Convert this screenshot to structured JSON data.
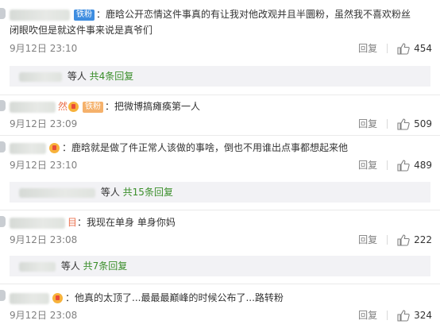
{
  "comments": [
    {
      "badge": "铁粉",
      "text": "：鹿晗公开恋情这件事真的有让我对他改观并且半圜粉，虽然我不喜欢粉丝",
      "text2": "闭眼吹但是就这件事来说是真爷们",
      "time": "9月12日 23:10",
      "reply": "回复",
      "likes": "454",
      "subreply": {
        "who": "等人",
        "count": "共4条回复"
      }
    },
    {
      "name_tail": "然",
      "badge": "铁粉",
      "text": "：把微博搞瘫痪第一人",
      "time": "9月12日 23:09",
      "reply": "回复",
      "likes": "509"
    },
    {
      "text": "：鹿晗就是做了件正常人该做的事啥，倒也不用谁出点事都想起来他",
      "time": "9月12日 23:10",
      "reply": "回复",
      "likes": "489",
      "subreply": {
        "who": "等人",
        "count": "共15条回复"
      }
    },
    {
      "name_tail": "目",
      "text": "：我现在单身  单身你妈",
      "time": "9月12日 23:08",
      "reply": "回复",
      "likes": "222",
      "subreply": {
        "who": "等人",
        "count": "共7条回复"
      }
    },
    {
      "text": "：他真的太顶了...最最最巅峰的时候公布了...路转粉",
      "time": "9月12日 23:08",
      "reply": "回复",
      "likes": "324"
    }
  ],
  "colors": {
    "link_green": "#3a8e2a",
    "badge_blue": "#3e8de0",
    "badge_orange": "#f5b16b",
    "muted": "#808080"
  }
}
